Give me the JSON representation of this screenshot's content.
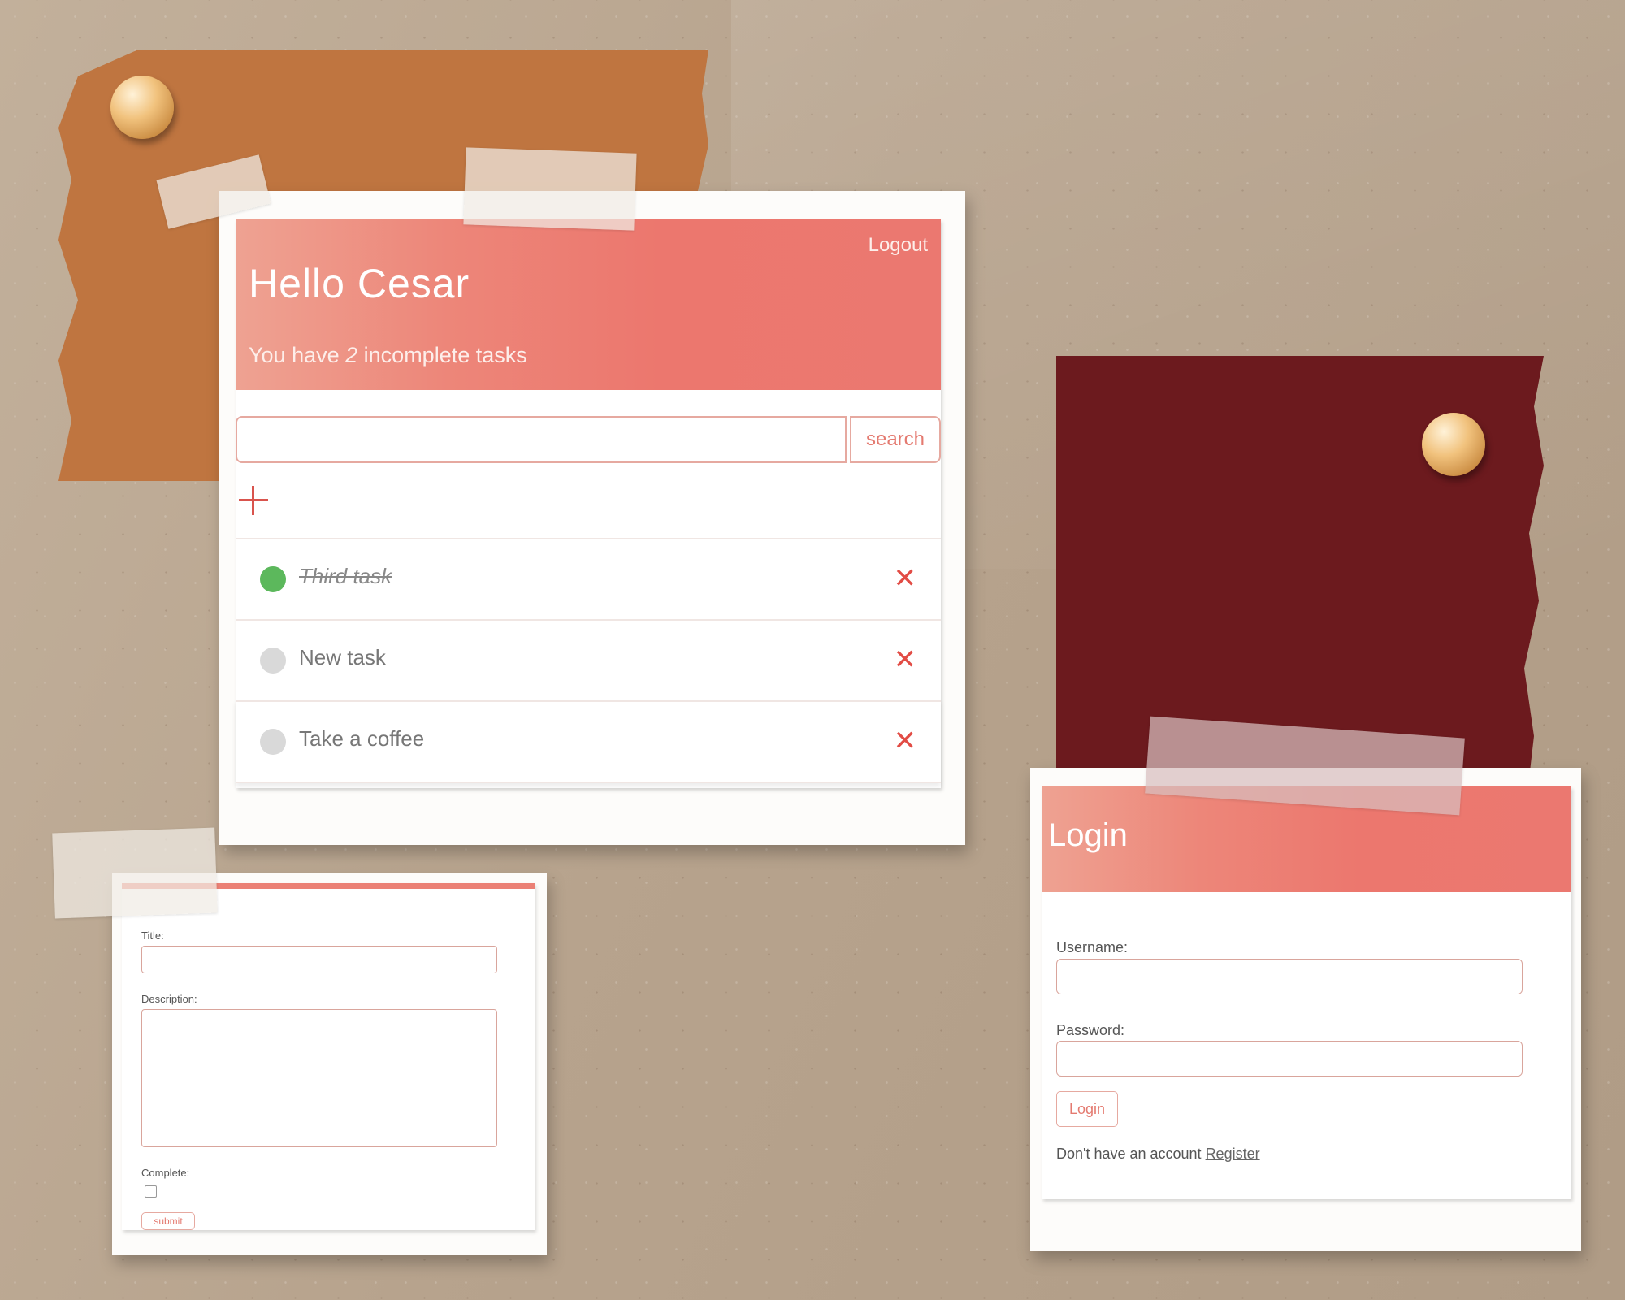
{
  "todo": {
    "logout_label": "Logout",
    "greeting": "Hello Cesar",
    "summary_prefix": "You have ",
    "incomplete_count": "2",
    "summary_suffix": " incomplete tasks",
    "search": {
      "value": "",
      "button_label": "search"
    },
    "add_icon": "plus-icon",
    "delete_icon_glyph": "✕",
    "tasks": [
      {
        "title": "Third task",
        "complete": true
      },
      {
        "title": "New task",
        "complete": false
      },
      {
        "title": "Take a coffee",
        "complete": false
      }
    ]
  },
  "task_form": {
    "title_label": "Title:",
    "title_value": "",
    "description_label": "Description:",
    "description_value": "",
    "complete_label": "Complete:",
    "complete_checked": false,
    "submit_label": "submit"
  },
  "login": {
    "title": "Login",
    "username_label": "Username:",
    "username_value": "",
    "password_label": "Password:",
    "password_value": "",
    "button_label": "Login",
    "register_prompt": "Don't have an account ",
    "register_link": "Register"
  },
  "colors": {
    "accent": "#ec776e",
    "accent_light": "#eea292",
    "complete_green": "#5cb85c",
    "incomplete_gray": "#d9d9d9",
    "delete_red": "#e24c45",
    "board_background": "#b9a58f",
    "paper_orange": "#bf7540",
    "paper_maroon": "#6c1a1e"
  }
}
